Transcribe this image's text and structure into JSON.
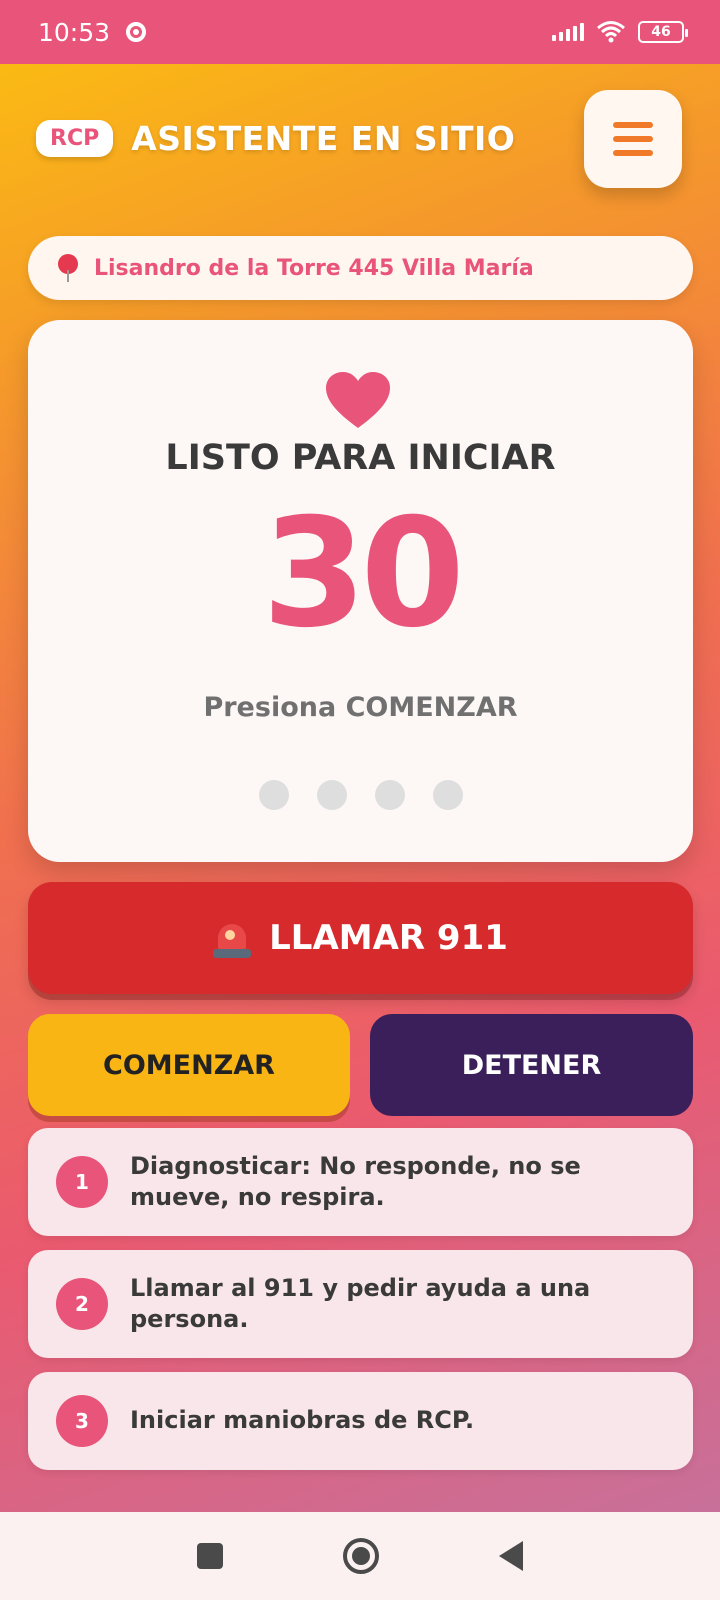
{
  "status_bar": {
    "time": "10:53",
    "battery": "46"
  },
  "header": {
    "badge": "RCP",
    "title": "ASISTENTE EN SITIO"
  },
  "location": {
    "address": "Lisandro de la Torre 445 Villa María"
  },
  "card": {
    "status": "LISTO PARA INICIAR",
    "counter": "30",
    "hint": "Presiona COMENZAR",
    "dots_total": 4,
    "dots_active": 0
  },
  "actions": {
    "call": "LLAMAR 911",
    "start": "COMENZAR",
    "stop": "DETENER"
  },
  "steps": [
    {
      "number": "1",
      "text": "Diagnosticar: No responde, no se mueve, no respira."
    },
    {
      "number": "2",
      "text": "Llamar al 911 y pedir ayuda a una persona."
    },
    {
      "number": "3",
      "text": "Iniciar maniobras de RCP."
    }
  ],
  "colors": {
    "accent": "#e9547a",
    "call": "#d62a2d",
    "start": "#f9b514",
    "stop": "#3a1f5a"
  },
  "icons": {
    "menu": "hamburger-icon",
    "location": "pin-icon",
    "heart": "heart-icon",
    "call": "siren-icon"
  }
}
